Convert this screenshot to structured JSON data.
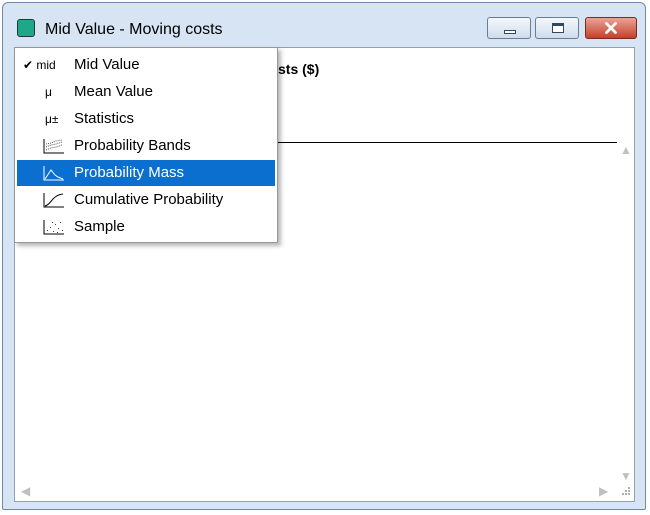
{
  "window": {
    "title": "Mid Value - Moving costs",
    "buttons": {
      "minimize": "minimize-icon",
      "maximize": "maximize-icon",
      "close": "close-icon"
    }
  },
  "content": {
    "header_partial": "sts ($)"
  },
  "menu": {
    "items": [
      {
        "icon_text": "mid",
        "label": "Mid Value",
        "checked": true
      },
      {
        "icon_text": "μ",
        "label": "Mean Value"
      },
      {
        "icon_text": "μ±",
        "label": "Statistics"
      },
      {
        "icon": "probability-bands-icon",
        "label": "Probability Bands"
      },
      {
        "icon": "probability-mass-icon",
        "label": "Probability Mass",
        "highlighted": true
      },
      {
        "icon": "cumulative-probability-icon",
        "label": "Cumulative Probability"
      },
      {
        "icon": "sample-icon",
        "label": "Sample"
      }
    ]
  },
  "colors": {
    "highlight": "#0a6fcf",
    "app_icon": "#1fa78a",
    "close_button": "#c5402a"
  }
}
